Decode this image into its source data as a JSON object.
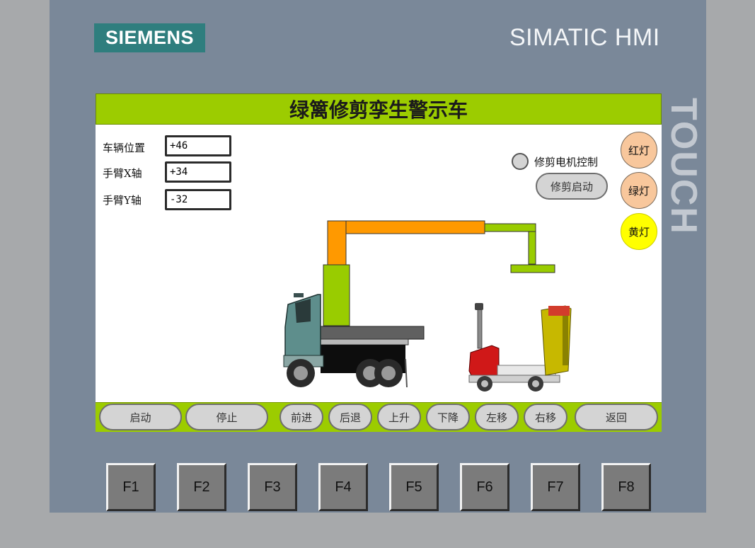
{
  "device": {
    "brand_logo": "SIEMENS",
    "product_name": "SIMATIC HMI",
    "side_label": "TOUCH"
  },
  "screen": {
    "title": "绿篱修剪孪生警示车",
    "readouts": [
      {
        "label": "车辆位置",
        "value": "+46"
      },
      {
        "label": "手臂X轴",
        "value": "+34"
      },
      {
        "label": "手臂Y轴",
        "value": "-32"
      }
    ],
    "motor": {
      "label": "修剪电机控制",
      "button_label": "修剪启动"
    },
    "lamps": [
      {
        "label": "红灯",
        "color": "#f8c79c"
      },
      {
        "label": "绿灯",
        "color": "#f8c79c"
      },
      {
        "label": "黄灯",
        "color": "#ffff00"
      }
    ],
    "controls": [
      {
        "label": "启动"
      },
      {
        "label": "停止"
      },
      {
        "label": "前进"
      },
      {
        "label": "后退"
      },
      {
        "label": "上升"
      },
      {
        "label": "下降"
      },
      {
        "label": "左移"
      },
      {
        "label": "右移"
      },
      {
        "label": "返回"
      }
    ]
  },
  "function_keys": [
    "F1",
    "F2",
    "F3",
    "F4",
    "F5",
    "F6",
    "F7",
    "F8"
  ],
  "colors": {
    "accent_green": "#9ccc00",
    "bezel": "#7a8899",
    "logo_teal": "#2f7e7e",
    "boom_orange": "#ff9900",
    "boom_green": "#99cc00"
  }
}
